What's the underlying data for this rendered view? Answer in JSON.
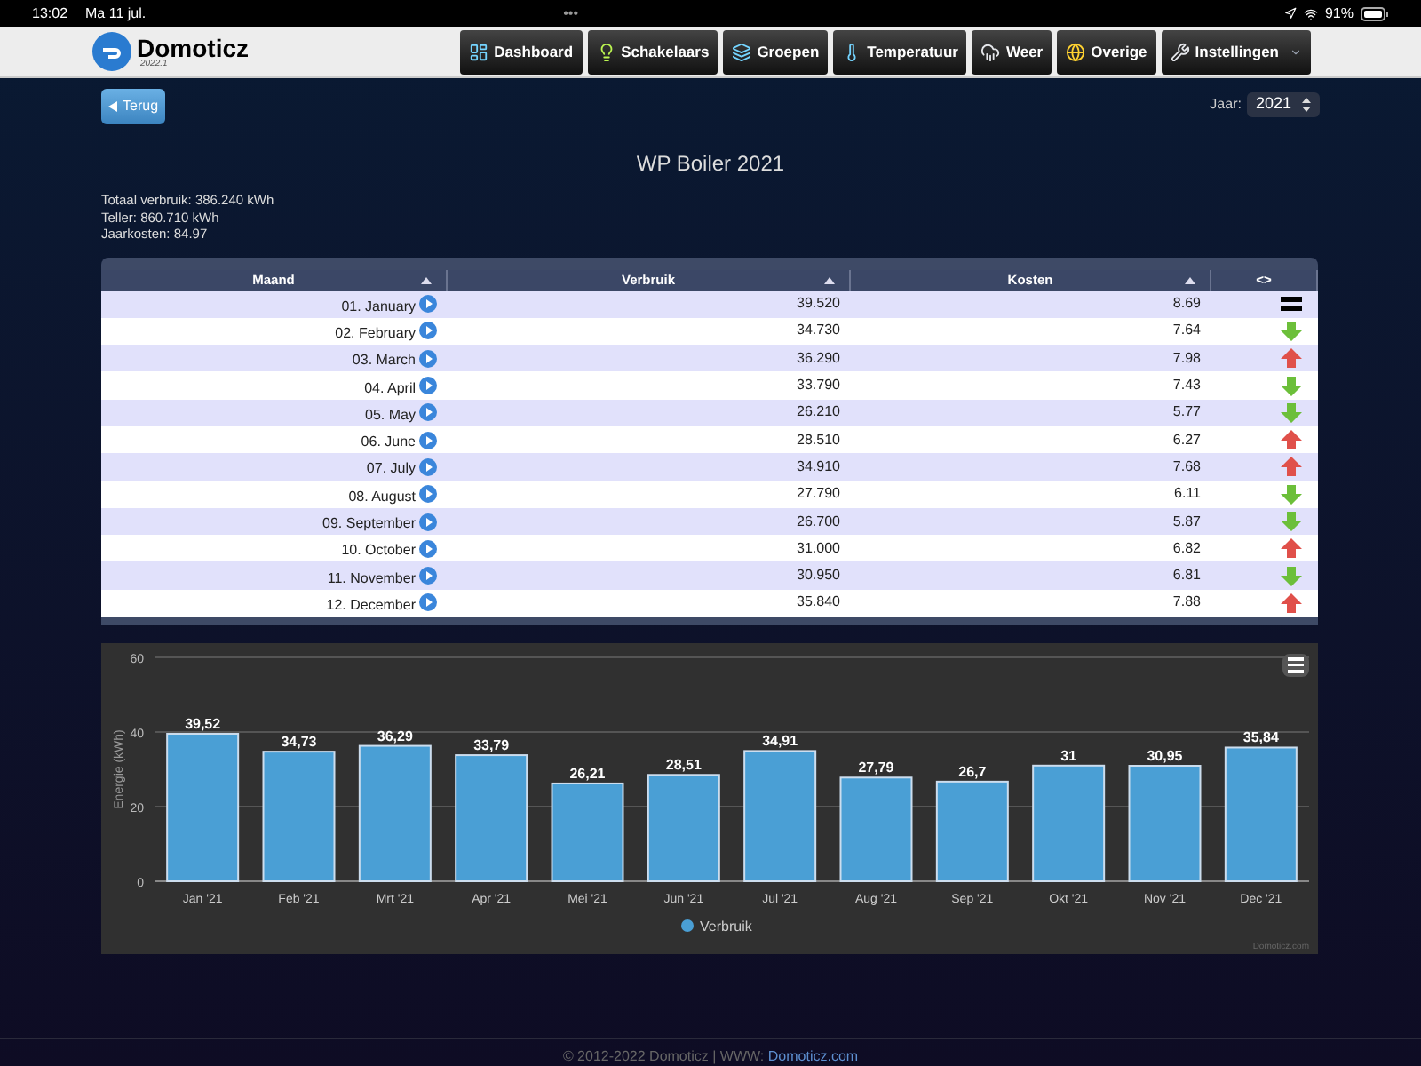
{
  "status_bar": {
    "time": "13:02",
    "date": "Ma 11 jul.",
    "dots": "•••",
    "battery": "91%"
  },
  "header": {
    "logo": "Domoticz",
    "version": "2022.1",
    "nav": [
      {
        "label": "Dashboard",
        "kind": "dashboard",
        "has_menu": false
      },
      {
        "label": "Schakelaars",
        "kind": "switches",
        "has_menu": false
      },
      {
        "label": "Groepen",
        "kind": "groups",
        "has_menu": false
      },
      {
        "label": "Temperatuur",
        "kind": "temperature",
        "has_menu": false
      },
      {
        "label": "Weer",
        "kind": "weather",
        "has_menu": false
      },
      {
        "label": "Overige",
        "kind": "utility",
        "has_menu": false
      },
      {
        "label": "Instellingen",
        "kind": "settings",
        "has_menu": true
      }
    ]
  },
  "back_button": "Terug",
  "year": {
    "label": "Jaar:",
    "value": "2021"
  },
  "title": "WP Boiler 2021",
  "summary": [
    "Totaal verbruik: 386.240 kWh",
    "Teller: 860.710 kWh",
    "Jaarkosten: 84.97"
  ],
  "table": {
    "columns": [
      "Maand",
      "Verbruik",
      "Kosten",
      "<>"
    ],
    "rows": [
      {
        "month": "01. January",
        "usage": "39.520",
        "cost": "8.69",
        "kind": "equal"
      },
      {
        "month": "02. February",
        "usage": "34.730",
        "cost": "7.64",
        "kind": "down"
      },
      {
        "month": "03. March",
        "usage": "36.290",
        "cost": "7.98",
        "kind": "up"
      },
      {
        "month": "04. April",
        "usage": "33.790",
        "cost": "7.43",
        "kind": "down"
      },
      {
        "month": "05. May",
        "usage": "26.210",
        "cost": "5.77",
        "kind": "down"
      },
      {
        "month": "06. June",
        "usage": "28.510",
        "cost": "6.27",
        "kind": "up"
      },
      {
        "month": "07. July",
        "usage": "34.910",
        "cost": "7.68",
        "kind": "up"
      },
      {
        "month": "08. August",
        "usage": "27.790",
        "cost": "6.11",
        "kind": "down"
      },
      {
        "month": "09. September",
        "usage": "26.700",
        "cost": "5.87",
        "kind": "down"
      },
      {
        "month": "10. October",
        "usage": "31.000",
        "cost": "6.82",
        "kind": "up"
      },
      {
        "month": "11. November",
        "usage": "30.950",
        "cost": "6.81",
        "kind": "down"
      },
      {
        "month": "12. December",
        "usage": "35.840",
        "cost": "7.88",
        "kind": "up"
      }
    ]
  },
  "chart": {
    "credits": "Domoticz.com",
    "chart_data": {
      "type": "bar",
      "ylabel": "Energie (kWh)",
      "categories": [
        "Jan '21",
        "Feb '21",
        "Mrt '21",
        "Apr '21",
        "Mei '21",
        "Jun '21",
        "Jul '21",
        "Aug '21",
        "Sep '21",
        "Okt '21",
        "Nov '21",
        "Dec '21"
      ],
      "series": [
        {
          "name": "Verbruik",
          "color": "#4a9fd5",
          "values": [
            39.52,
            34.73,
            36.29,
            33.79,
            26.21,
            28.51,
            34.91,
            27.79,
            26.7,
            31,
            30.95,
            35.84
          ]
        }
      ],
      "ylim": [
        0,
        60
      ],
      "yticks": [
        0,
        20,
        40,
        60
      ],
      "value_labels": [
        "39,52",
        "34,73",
        "36,29",
        "33,79",
        "26,21",
        "28,51",
        "34,91",
        "27,79",
        "26,7",
        "31",
        "30,95",
        "35,84"
      ]
    }
  },
  "footer": {
    "text": "© 2012-2022 Domoticz | WWW:",
    "link": "Domoticz.com"
  }
}
